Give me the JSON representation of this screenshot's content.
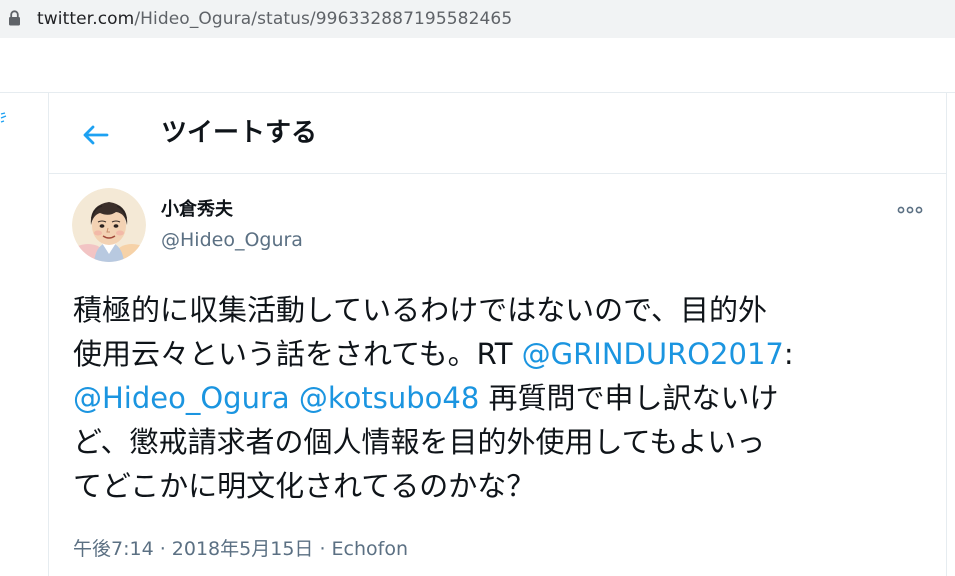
{
  "browser": {
    "url_host": "twitter.com",
    "url_path": "/Hideo_Ogura/status/996332887195582465"
  },
  "header": {
    "title": "ツイートする",
    "back_icon": "arrow-left-icon"
  },
  "tweet": {
    "author": {
      "display_name": "小倉秀夫",
      "handle": "@Hideo_Ogura"
    },
    "more_icon": "more-horizontal-icon",
    "text": {
      "line1": "積極的に収集活動しているわけではないので、目的外",
      "line2_text": "使用云々という話をされても。RT ",
      "line2_mention": "@GRINDURO2017",
      "line2_colon": ":",
      "line3_mention1": "@Hideo_Ogura",
      "line3_space": " ",
      "line3_mention2": "@kotsubo48",
      "line3_text": " 再質問で申し訳ないけ",
      "line4": "ど、懲戒請求者の個人情報を目的外使用してもよいっ",
      "line5": "てどこかに明文化されてるのかな？"
    },
    "time": "午後7:14",
    "separator1": " · ",
    "date": "2018年5月15日",
    "separator2": " · ",
    "source": "Echofon"
  },
  "colors": {
    "link": "#1b95e0",
    "muted": "#5b7083",
    "text": "#0f1419",
    "border": "#e6ecf0",
    "address_bar": "#f1f3f4"
  }
}
